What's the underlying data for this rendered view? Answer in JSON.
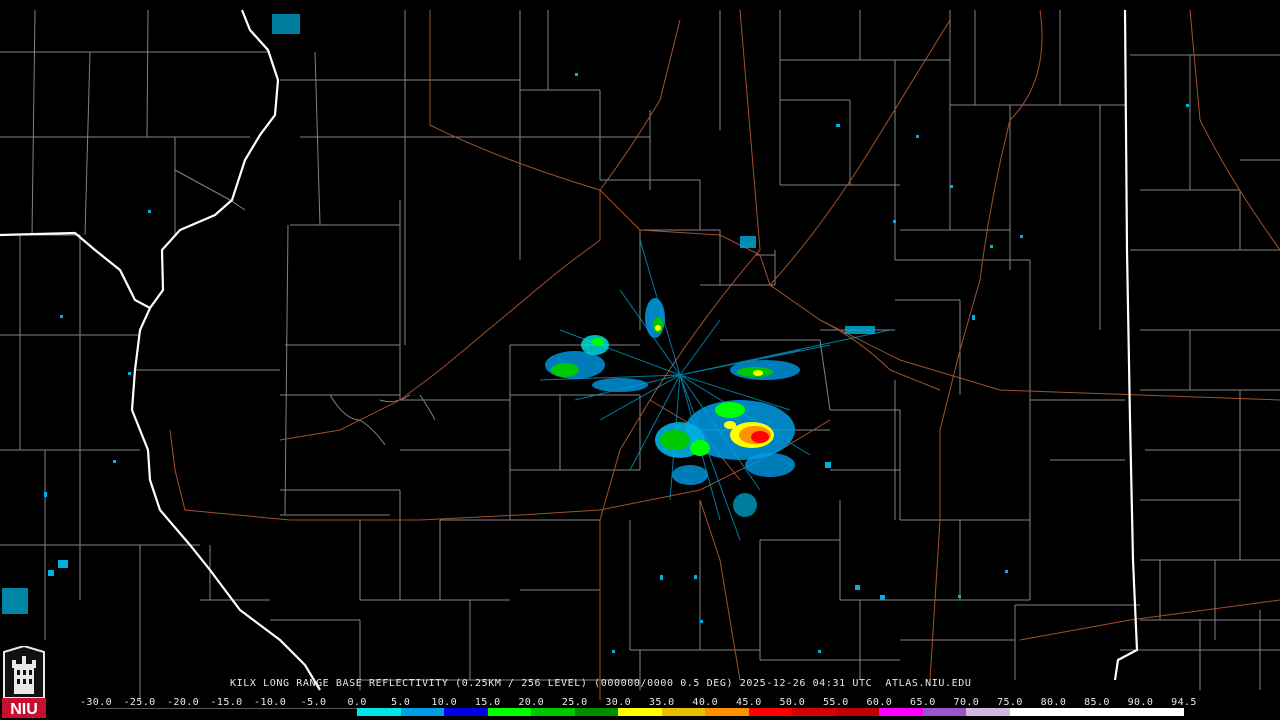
{
  "product": {
    "title": "KILX LONG RANGE BASE REFLECTIVITY (0.25KM / 256 LEVEL) (000000/0000 0.5 DEG) 2025-12-26 04:31 UTC  ATLAS.NIU.EDU",
    "radar_site": "KILX",
    "timestamp": "2025-12-26 04:31 UTC",
    "source": "ATLAS.NIU.EDU"
  },
  "logo": {
    "text": "NIU",
    "color": "#c8102e"
  },
  "legend": {
    "ticks": [
      "-30.0",
      "-25.0",
      "-20.0",
      "-15.0",
      "-10.0",
      "-5.0",
      "0.0",
      "5.0",
      "10.0",
      "15.0",
      "20.0",
      "25.0",
      "30.0",
      "35.0",
      "40.0",
      "45.0",
      "50.0",
      "55.0",
      "60.0",
      "65.0",
      "70.0",
      "75.0",
      "80.0",
      "85.0",
      "90.0",
      "94.5"
    ],
    "colors": [
      "#000000",
      "#000000",
      "#000000",
      "#000000",
      "#000000",
      "#000000",
      "#00e6e6",
      "#009ce6",
      "#0000e6",
      "#00ff00",
      "#00c800",
      "#008c00",
      "#ffff00",
      "#e6bf00",
      "#ff9000",
      "#ff0000",
      "#d60000",
      "#c00000",
      "#ff00ff",
      "#9955c9",
      "#d0b8e0",
      "#ffffff",
      "#ffffff",
      "#ffffff",
      "#ffffff"
    ]
  },
  "colors": {
    "state_border": "#ffffff",
    "county_border": "#aaaaaa",
    "highway": "#a0522d"
  }
}
